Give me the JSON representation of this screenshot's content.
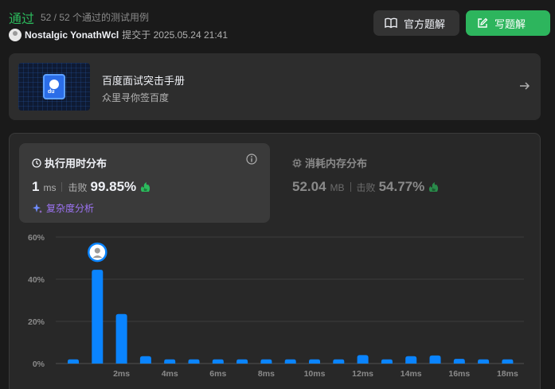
{
  "header": {
    "status": "通过",
    "cases": "52 / 52 个通过的测试用例",
    "username": "Nostalgic YonathWcl",
    "submitted": "提交于 2025.05.24 21:41",
    "official_solution_label": "官方题解",
    "write_solution_label": "写题解"
  },
  "promo": {
    "title": "百度面试突击手册",
    "subtitle": "众里寻你签百度",
    "logo_text": "du"
  },
  "runtime": {
    "title": "执行用时分布",
    "value": "1",
    "unit": "ms",
    "beat_label": "击败",
    "percent": "99.85%",
    "complexity_label": "复杂度分析"
  },
  "memory": {
    "title": "消耗内存分布",
    "value": "52.04",
    "unit": "MB",
    "beat_label": "击败",
    "percent": "54.77%"
  },
  "colors": {
    "accepted": "#2cbb5d",
    "bar": "#0a84ff",
    "write_button": "#2db55d",
    "complexity": "#9e74f5"
  },
  "chart_data": {
    "type": "bar",
    "y_ticks": [
      "60%",
      "40%",
      "20%",
      "0%"
    ],
    "ylim": [
      0,
      60
    ],
    "x_tick_labels": [
      "2ms",
      "4ms",
      "6ms",
      "8ms",
      "10ms",
      "12ms",
      "14ms",
      "16ms",
      "18ms"
    ],
    "categories": [
      "0ms",
      "1ms",
      "2ms",
      "3ms",
      "4ms",
      "5ms",
      "6ms",
      "7ms",
      "8ms",
      "9ms",
      "10ms",
      "11ms",
      "12ms",
      "13ms",
      "14ms",
      "15ms",
      "16ms",
      "17ms",
      "18ms"
    ],
    "values": [
      2.0,
      44.5,
      23.5,
      3.5,
      2.0,
      2.0,
      2.0,
      2.0,
      2.0,
      2.0,
      2.0,
      2.0,
      4.0,
      2.0,
      3.5,
      3.8,
      2.2,
      2.0,
      2.0
    ],
    "highlight_index": 1
  }
}
